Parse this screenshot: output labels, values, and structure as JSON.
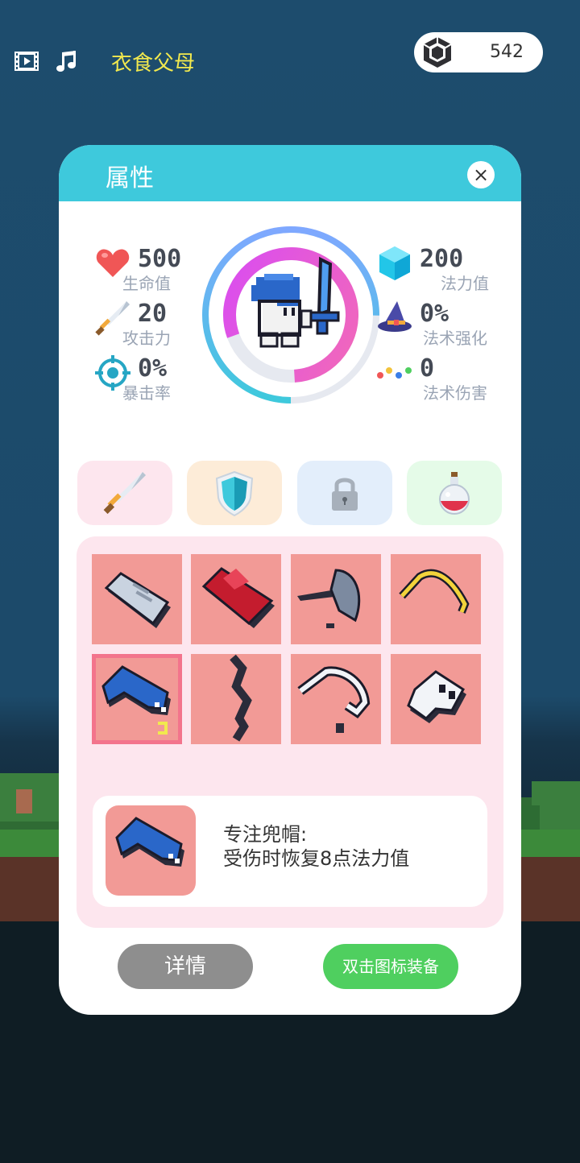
{
  "top_bar": {
    "title": "衣食父母",
    "currency_amount": "542",
    "icons": [
      "film-icon",
      "music-icon",
      "gem-icon"
    ]
  },
  "panel": {
    "title": "属性",
    "close_label": "×"
  },
  "stats_left": [
    {
      "icon": "heart-icon",
      "value": "500",
      "label": "生命值"
    },
    {
      "icon": "sword-icon",
      "value": "20",
      "label": "攻击力"
    },
    {
      "icon": "crosshair-icon",
      "value": "0%",
      "label": "暴击率"
    }
  ],
  "stats_right": [
    {
      "icon": "crystal-icon",
      "value": "200",
      "label": "法力值"
    },
    {
      "icon": "wizard-hat-icon",
      "value": "0%",
      "label": "法术强化"
    },
    {
      "icon": "dots-icon",
      "value": "0",
      "label": "法术伤害"
    }
  ],
  "tabs": [
    "sword-tab",
    "shield-tab",
    "locked-tab",
    "potion-tab"
  ],
  "inventory": [
    "gauntlet-item",
    "red-cape-item",
    "axe-item",
    "gold-bow-item",
    "blue-hood-item",
    "dark-bolt-item",
    "scythe-item",
    "skull-helm-item"
  ],
  "detail": {
    "name": "专注兜帽:",
    "description": "受伤时恢复8点法力值"
  },
  "buttons": {
    "detail": "详情",
    "equip": "双击图标装备"
  },
  "colors": {
    "header": "#3ec9dc",
    "slot": "#f29a96",
    "detail_button": "#8e8e8e",
    "equip_button": "#4fcf5f",
    "title_yellow": "#f2e94e"
  }
}
